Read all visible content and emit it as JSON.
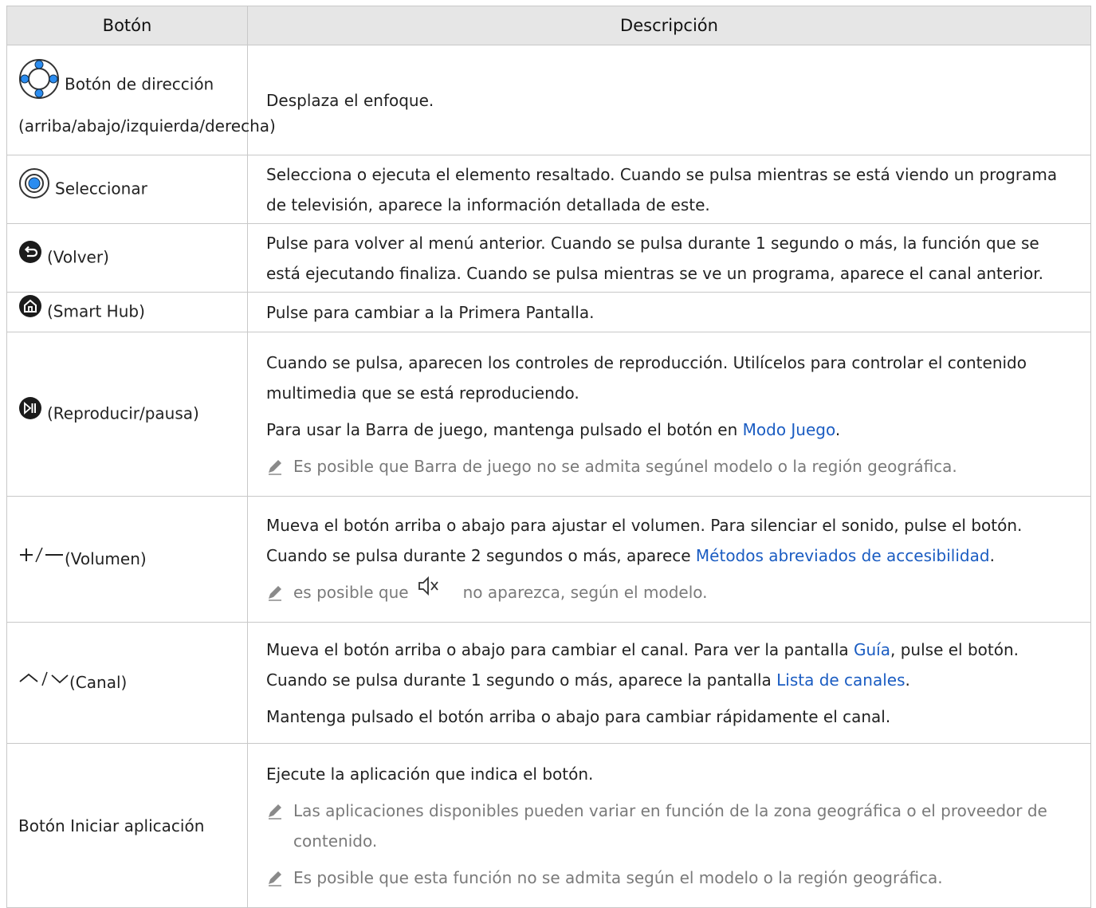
{
  "header": {
    "col_button": "Botón",
    "col_description": "Descripción"
  },
  "rows": [
    {
      "button": "Botón de dirección (arriba/abajo/izquierda/derecha)",
      "icon": "dpad-icon",
      "description": "Desplaza el enfoque."
    },
    {
      "button": "Seleccionar",
      "icon": "select-icon",
      "description": "Selecciona o ejecuta el elemento resaltado. Cuando se pulsa mientras se está viendo un programa de televisión, aparece la información detallada de este."
    },
    {
      "button": "(Volver)",
      "icon": "back-icon",
      "description": "Pulse para volver al menú anterior. Cuando se pulsa durante 1 segundo o más, la función que se está ejecutando finaliza. Cuando se pulsa mientras se ve un programa, aparece el canal anterior."
    },
    {
      "button": "(Smart Hub)",
      "icon": "home-icon",
      "description": "Pulse para cambiar a la Primera Pantalla."
    },
    {
      "button": "(Reproducir/pausa)",
      "icon": "play-pause-icon",
      "description_1": "Cuando se pulsa, aparecen los controles de reproducción. Utilícelos para controlar el contenido multimedia que se está reproduciendo.",
      "description_2_pre": "Para usar la Barra de juego, mantenga pulsado el botón en ",
      "description_2_link": "Modo Juego",
      "description_2_post": ".",
      "note": "Es posible que Barra de juego no se admita segúnel modelo o la región geográfica."
    },
    {
      "button": "(Volumen)",
      "icon": "plus-minus-icon",
      "symbols": "+/−",
      "description_pre": "Mueva el botón arriba o abajo para ajustar el volumen. Para silenciar el sonido, pulse el botón. Cuando se pulsa durante 2 segundos o más, aparece ",
      "description_link": "Métodos abreviados de accesibilidad",
      "description_post": ".",
      "note_pre": "es posible que",
      "note_post": "no aparezca, según el modelo."
    },
    {
      "button": "(Canal)",
      "icon": "channel-arrows-icon",
      "symbols_sep": "/",
      "d1_pre": "Mueva el botón arriba o abajo para cambiar el canal. Para ver la pantalla ",
      "d1_link": "Guía",
      "d1_mid": ", pulse el botón. Cuando se pulsa durante 1 segundo o más, aparece la pantalla ",
      "d1_link2": "Lista de canales",
      "d1_post": ".",
      "description_2": "Mantenga pulsado el botón arriba o abajo para cambiar rápidamente el canal."
    },
    {
      "button": "Botón Iniciar aplicación",
      "description": "Ejecute la aplicación que indica el botón.",
      "note_1": "Las aplicaciones disponibles pueden variar en función de la zona geográfica o el proveedor de contenido.",
      "note_2": "Es posible que esta función no se admita según el modelo o la región geográfica."
    }
  ],
  "colors": {
    "header_bg": "#e6e6e6",
    "link": "#1a5cc2",
    "note_text": "#7a7a7a",
    "icon_blue": "#1e90ff"
  }
}
